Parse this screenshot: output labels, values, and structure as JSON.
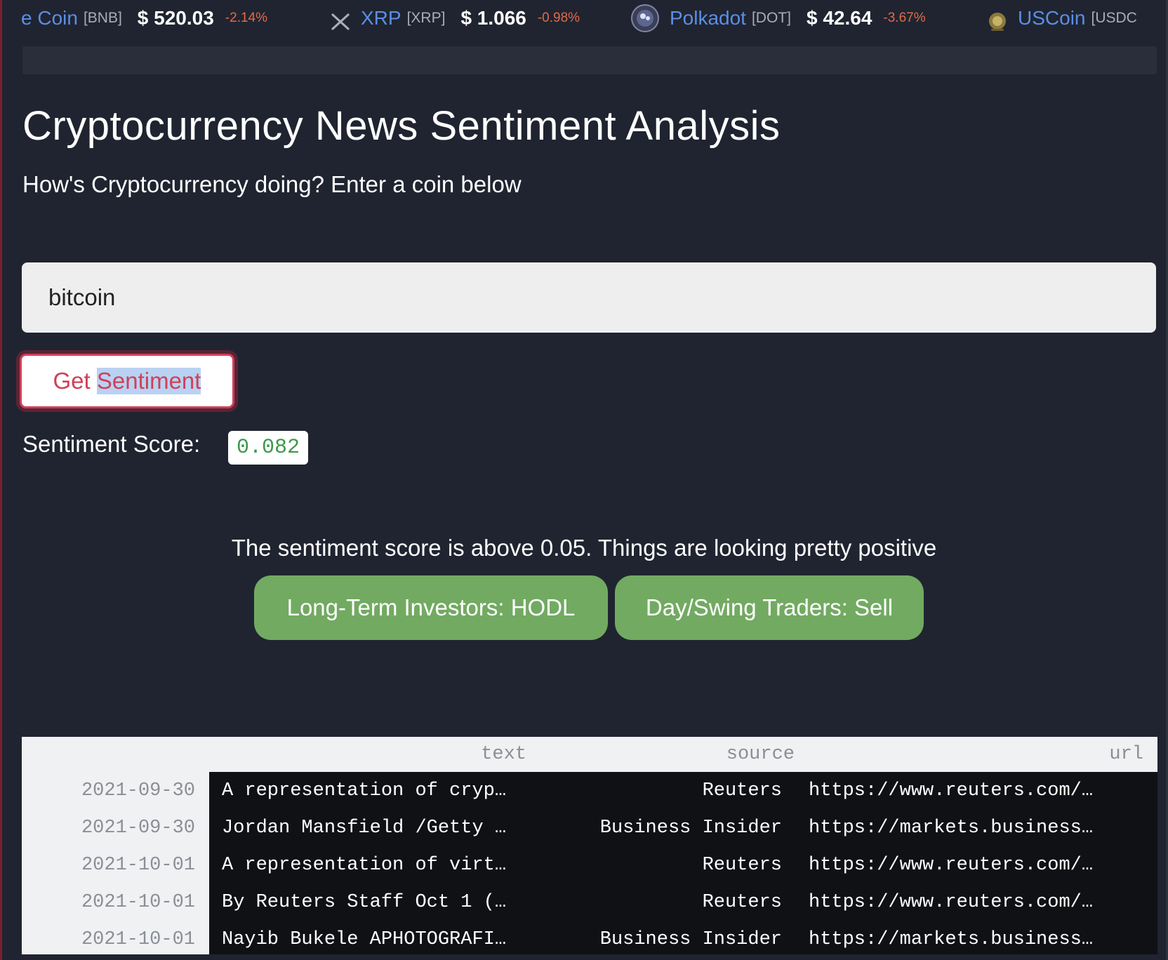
{
  "ticker": [
    {
      "name": "e Coin",
      "symbol": "[BNB]",
      "price": "$ 520.03",
      "change": "-2.14%",
      "icon": "binance-icon"
    },
    {
      "name": "XRP",
      "symbol": "[XRP]",
      "price": "$ 1.066",
      "change": "-0.98%",
      "icon": "xrp-icon"
    },
    {
      "name": "Polkadot",
      "symbol": "[DOT]",
      "price": "$ 42.64",
      "change": "-3.67%",
      "icon": "polkadot-icon"
    },
    {
      "name": "USCoin",
      "symbol": "[USDC",
      "price": "",
      "change": "",
      "icon": "usdcoin-icon"
    }
  ],
  "page": {
    "title": "Cryptocurrency News Sentiment Analysis",
    "subtitle": "How's Cryptocurrency doing? Enter a coin below"
  },
  "search": {
    "value": "bitcoin",
    "button_prefix": "Get ",
    "button_selected": "Sentiment"
  },
  "result": {
    "score_label": "Sentiment Score:",
    "score_value": "0.082",
    "message": "The sentiment score is above 0.05. Things are looking pretty positive",
    "long_term": "Long-Term Investors: HODL",
    "day_swing": "Day/Swing Traders: Sell"
  },
  "table": {
    "columns": [
      "text",
      "source",
      "url"
    ],
    "rows": [
      {
        "date": "2021-09-30",
        "text": "A representation of cryp…",
        "source": "Reuters",
        "url": "https://www.reuters.com/…"
      },
      {
        "date": "2021-09-30",
        "text": "Jordan Mansfield /Getty …",
        "source": "Business Insider",
        "url": "https://markets.business…"
      },
      {
        "date": "2021-10-01",
        "text": "A representation of virt…",
        "source": "Reuters",
        "url": "https://www.reuters.com/…"
      },
      {
        "date": "2021-10-01",
        "text": "By Reuters Staff Oct 1 (…",
        "source": "Reuters",
        "url": "https://www.reuters.com/…"
      },
      {
        "date": "2021-10-01",
        "text": "Nayib Bukele APHOTOGRAFI…",
        "source": "Business Insider",
        "url": "https://markets.business…"
      }
    ]
  },
  "colors": {
    "background": "#202430",
    "accent_red": "#cf4058",
    "positive_green": "#72aa62",
    "ticker_link": "#5b8ee6",
    "ticker_negative": "#e06a4a"
  }
}
